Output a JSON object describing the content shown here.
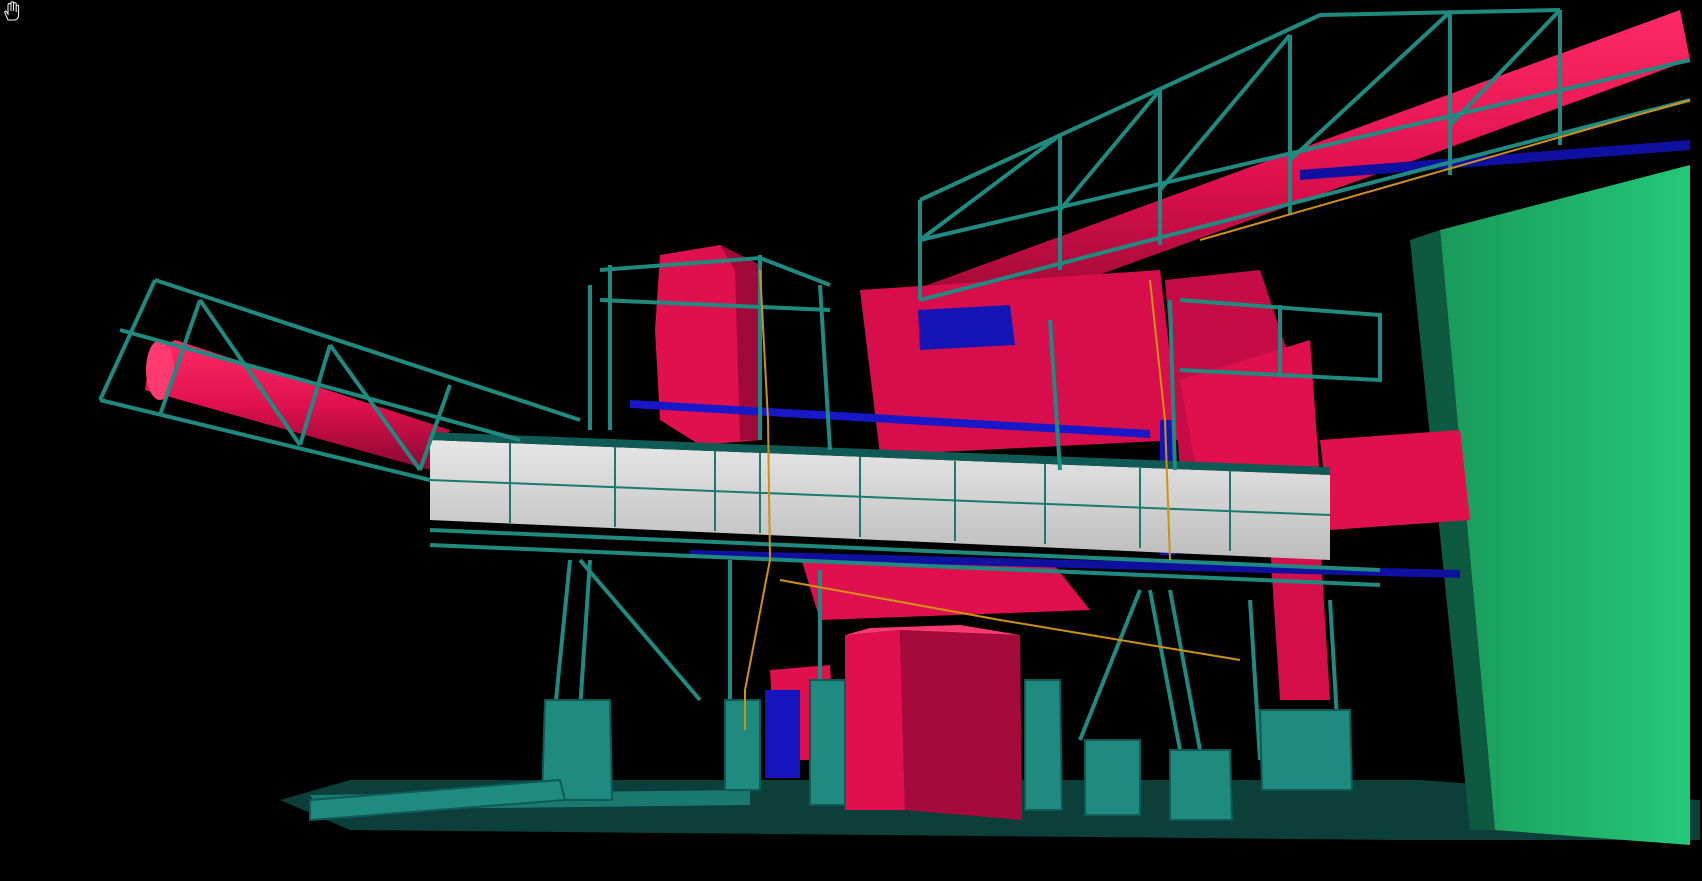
{
  "viewer": {
    "background_color": "#000000",
    "cursor": "pan-hand-icon",
    "colors": {
      "structure_teal": "#1f8a80",
      "structure_dark": "#0f5a55",
      "pipe_red": "#e0104f",
      "pipe_red_dark": "#a00a3a",
      "duct_blue": "#1010c0",
      "enclosure_gray": "#d8d8d8",
      "wall_green": "#20c070",
      "cable_orange": "#d09010"
    }
  }
}
